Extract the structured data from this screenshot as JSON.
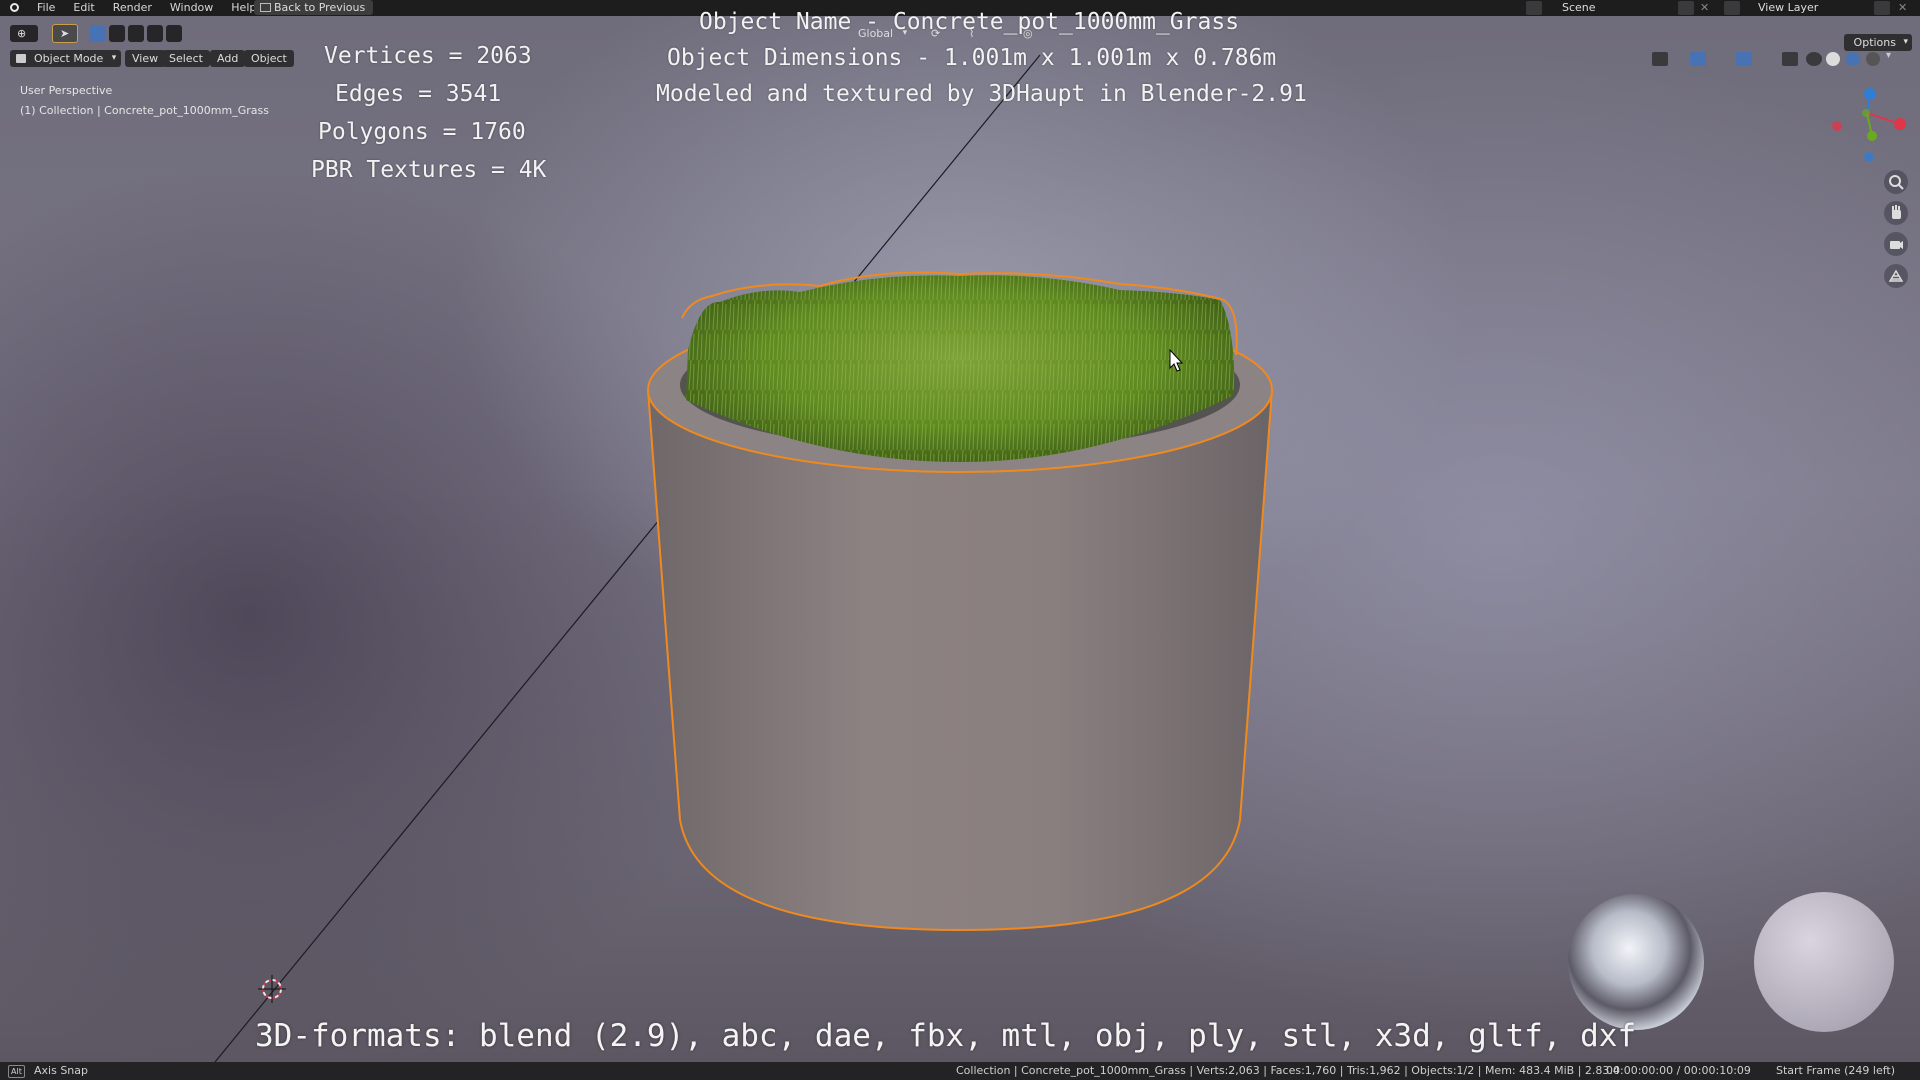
{
  "menu": [
    "File",
    "Edit",
    "Render",
    "Window",
    "Help"
  ],
  "back_button": "Back to Previous",
  "scene": {
    "label": "Scene"
  },
  "view_layer": {
    "label": "View Layer"
  },
  "toolbar": {
    "mode": "Object Mode",
    "view": "View",
    "select": "Select",
    "add": "Add",
    "object": "Object",
    "orientation": "Global",
    "options": "Options"
  },
  "viewport": {
    "perspective": "User Perspective",
    "collection": "(1) Collection | Concrete_pot_1000mm_Grass"
  },
  "overlay": {
    "vertices": "Vertices = 2063",
    "edges": "Edges = 3541",
    "polygons": "Polygons = 1760",
    "textures": "PBR Textures = 4K",
    "object_name": "Object Name - Concrete_pot_1000mm_Grass",
    "dimensions": "Object Dimensions -  1.001m x 1.001m x 0.786m",
    "credit": "Modeled and textured by 3DHaupt in Blender-2.91",
    "formats": "3D-formats: blend (2.9), abc, dae, fbx, mtl, obj, ply, stl, x3d, gltf, dxf"
  },
  "status": {
    "axis_snap": "Axis Snap",
    "alt_key": "Alt",
    "info": "Collection | Concrete_pot_1000mm_Grass | Verts:2,063 | Faces:1,760 | Tris:1,962 | Objects:1/2 | Mem: 483.4 MiB | 2.83.4",
    "time": "00:00:00:00 / 00:00:10:09",
    "frame": "Start Frame (249 left)"
  },
  "colors": {
    "selection_outline": "#f08a1e",
    "gizmo_x": "#e0364a",
    "gizmo_y": "#6aaa1e",
    "gizmo_z": "#2e7ed6"
  }
}
